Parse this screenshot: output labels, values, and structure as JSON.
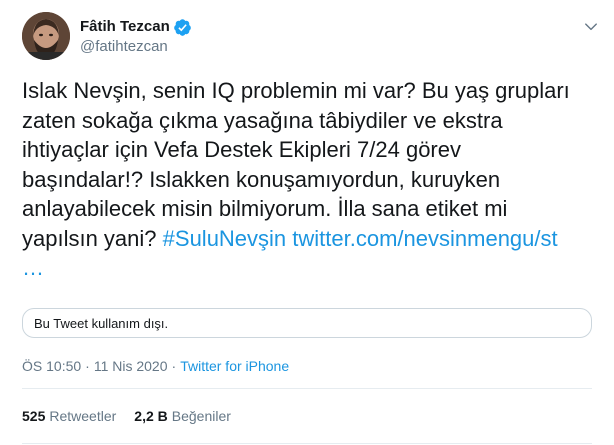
{
  "tweet": {
    "display_name": "Fâtih Tezcan",
    "handle": "@fatihtezcan",
    "verified": true,
    "body_lines": [
      "Islak Nevşin, senin IQ problemin mi var? Bu yaş grupları",
      "zaten sokağa çıkma yasağına tâbiydiler ve ekstra",
      "ihtiyaçlar için Vefa Destek Ekipleri 7/24 görev",
      "başındalar!?  Islakken konuşamıyordun, kuruyken",
      "anlayabilecek misin bilmiyorum. İlla sana etiket mi"
    ],
    "last_line_prefix": "yapılsın yani?",
    "hashtag": "#SuluNevşin",
    "link_text": "twitter.com/nevsinmengu/st",
    "ellipsis": "…",
    "withheld_notice": "Bu Tweet kullanım dışı.",
    "time": "ÖS 10:50",
    "date": "11 Nis 2020",
    "separator": "·",
    "source": "Twitter for iPhone",
    "retweets_count": "525",
    "retweets_label": "Retweetler",
    "likes_count": "2,2 B",
    "likes_label": "Beğeniler"
  },
  "icons": {
    "avatar": "avatar-photo",
    "verified": "verified-badge-icon",
    "caret": "chevron-down-icon"
  },
  "colors": {
    "accent": "#1b95e0",
    "verified": "#1da1f2",
    "muted": "#657786",
    "text": "#14171a",
    "border": "#e6ecf0"
  }
}
